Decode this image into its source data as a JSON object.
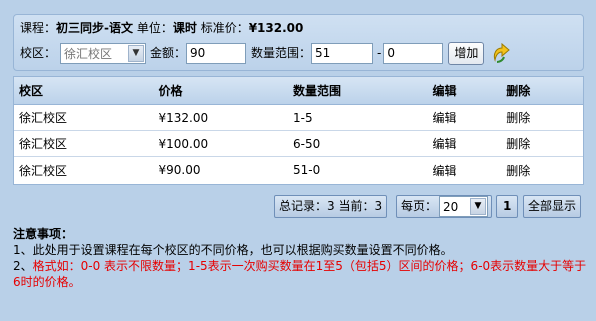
{
  "course": {
    "course_label": "课程：",
    "course_value": "初三同步-语文",
    "unit_label": "单位：",
    "unit_value": "课时",
    "price_label": "标准价：",
    "price_value": "¥132.00"
  },
  "form": {
    "campus_label": "校区：",
    "campus_selected": "徐汇校区",
    "amount_label": "金额：",
    "amount_value": "90",
    "range_label": "数量范围：",
    "range_from": "51",
    "range_sep": "-",
    "range_to": "0",
    "add_label": "增加"
  },
  "table": {
    "headers": [
      "校区",
      "价格",
      "数量范围",
      "编辑",
      "删除"
    ],
    "rows": [
      [
        "徐汇校区",
        "¥132.00",
        "1-5",
        "编辑",
        "删除"
      ],
      [
        "徐汇校区",
        "¥100.00",
        "6-50",
        "编辑",
        "删除"
      ],
      [
        "徐汇校区",
        "¥90.00",
        "51-0",
        "编辑",
        "删除"
      ]
    ]
  },
  "pager": {
    "summary": "总记录：3 当前：3",
    "per_page_label": "每页：",
    "per_page_value": "20",
    "page_number": "1",
    "show_all_label": "全部显示"
  },
  "notes": {
    "title": "注意事项：",
    "line1": "1、此处用于设置课程在每个校区的不同价格，也可以根据购买数量设置不同价格。",
    "line2_prefix": "2、",
    "line2_text": "格式如：0-0 表示不限数量；1-5表示一次购买数量在1至5（包括5）区间的价格；6-0表示数量大于等于6时的价格。"
  },
  "colors": {
    "background": "#b9d0e8",
    "note_red": "#e60000"
  },
  "icons": {
    "refresh": "refresh-arrow-icon"
  }
}
